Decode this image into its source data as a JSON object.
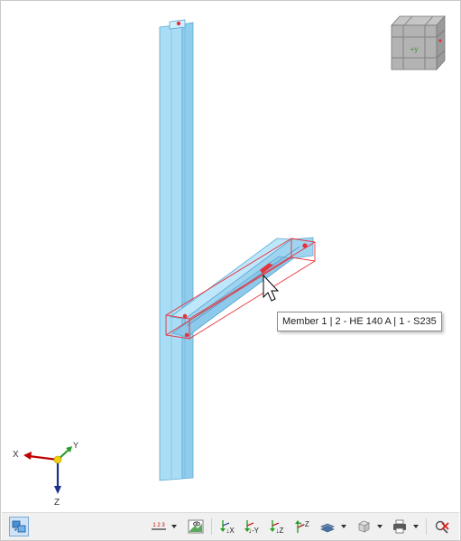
{
  "viewport": {
    "tooltip": "Member 1 | 2 - HE 140 A | 1 - S235",
    "view_cube_face": "+y",
    "axes": {
      "x": "X",
      "y": "Y",
      "z": "Z"
    }
  },
  "toolbar": {
    "numbering_label": "1 2 3",
    "view_buttons": [
      "↓X",
      "↓-Y",
      "↓Z",
      "↑-Z"
    ]
  },
  "colors": {
    "member_fill": "#a6daf5",
    "member_edge": "#5ba6cf",
    "selection": "#e8313a",
    "axis_x": "#c00000",
    "axis_y": "#2a9e2a",
    "axis_z": "#1b2f8c"
  }
}
